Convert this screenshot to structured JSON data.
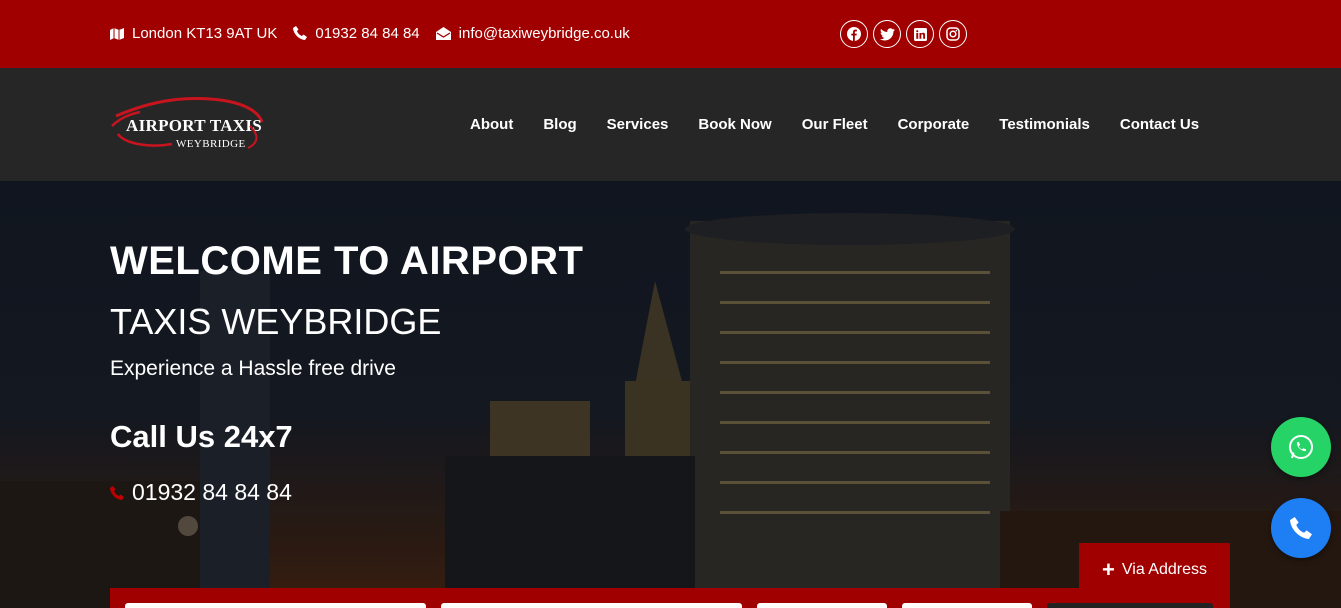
{
  "topbar": {
    "address": "London KT13 9AT UK",
    "phone": "01932 84 84 84",
    "email": "info@taxiweybridge.co.uk",
    "social": [
      "facebook-icon",
      "twitter-icon",
      "linkedin-icon",
      "instagram-icon"
    ]
  },
  "logo": {
    "line1": "AIRPORT TAXIS",
    "line2": "WEYBRIDGE"
  },
  "nav": [
    "About",
    "Blog",
    "Services",
    "Book Now",
    "Our Fleet",
    "Corporate",
    "Testimonials",
    "Contact Us"
  ],
  "hero": {
    "title": "WELCOME TO AIRPORT",
    "subtitle": "TAXIS WEYBRIDGE",
    "tagline": "Experience a Hassle free drive",
    "call_heading": "Call Us 24x7",
    "phone": "01932 84 84 84"
  },
  "booking": {
    "via_address": "Via Address"
  },
  "colors": {
    "brand_red": "#a00000",
    "nav_bg": "#262626",
    "whatsapp_green": "#25d366",
    "call_blue": "#1e7ff5"
  }
}
